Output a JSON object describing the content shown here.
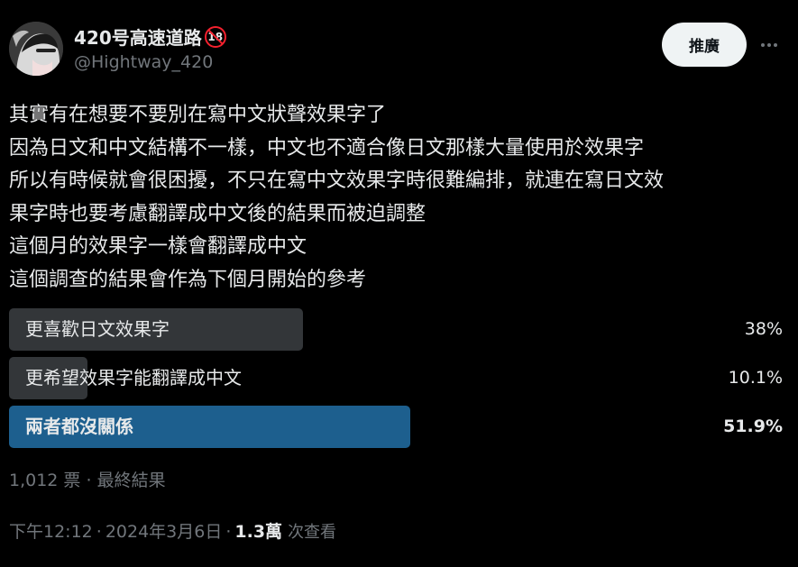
{
  "author": {
    "display_name": "420号高速道路",
    "age_badge": "18",
    "handle": "@Hightway_420"
  },
  "header": {
    "promote_label": "推廣"
  },
  "tweet": {
    "lines": [
      "其實有在想要不要別在寫中文狀聲效果字了",
      "因為日文和中文結構不一樣，中文也不適合像日文那樣大量使用於效果字",
      "所以有時候就會很困擾，不只在寫中文效果字時很難編排，就連在寫日文效",
      "果字時也要考慮翻譯成中文後的結果而被迫調整",
      "這個月的效果字一樣會翻譯成中文",
      "這個調查的結果會作為下個月開始的參考"
    ]
  },
  "poll": {
    "options": [
      {
        "label": "更喜歡日文效果字",
        "percent_text": "38%",
        "percent": 38,
        "winner": false
      },
      {
        "label": "更希望效果字能翻譯成中文",
        "percent_text": "10.1%",
        "percent": 10.1,
        "winner": false
      },
      {
        "label": "兩者都沒關係",
        "percent_text": "51.9%",
        "percent": 51.9,
        "winner": true
      }
    ],
    "votes": "1,012 票",
    "status": "最終結果"
  },
  "meta": {
    "time": "下午12:12",
    "date": "2024年3月6日",
    "views_count": "1.3萬",
    "views_label": "次查看"
  },
  "colors": {
    "background": "#000000",
    "text": "#e7e9ea",
    "muted": "#71767b",
    "poll_bar": "#333639",
    "poll_bar_winner": "#1d5f8e",
    "badge_red": "#f4212e"
  }
}
